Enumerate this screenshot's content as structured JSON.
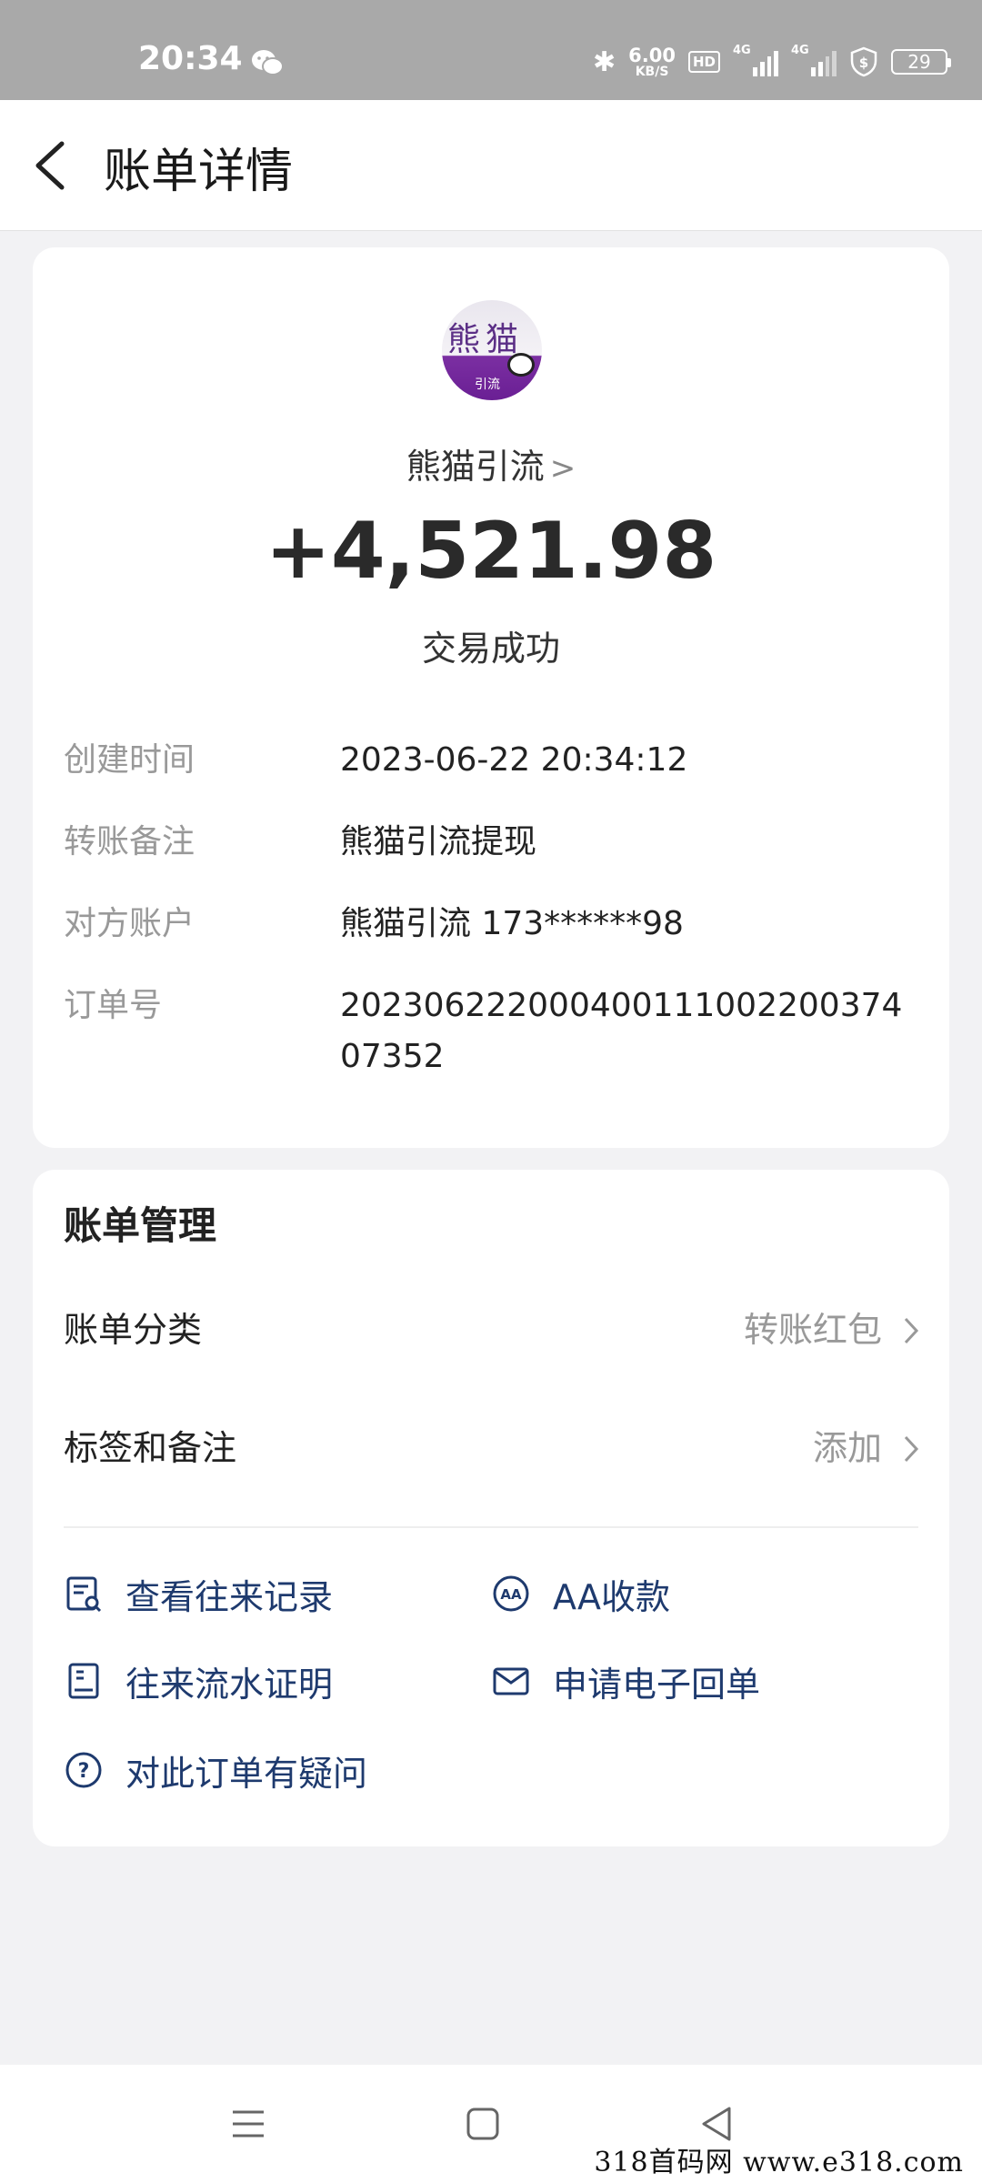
{
  "status_bar": {
    "time": "20:34",
    "speed_value": "6.00",
    "speed_unit": "KB/S",
    "hd_label": "HD",
    "signal_1_label": "4G",
    "signal_2_label": "4G",
    "battery": "29",
    "icons": [
      "wechat-icon",
      "bluetooth-icon",
      "hd-icon",
      "signal-icon",
      "signal-icon",
      "shield-icon",
      "battery-icon"
    ]
  },
  "header": {
    "title": "账单详情",
    "back_icon": "back-arrow-icon"
  },
  "transaction": {
    "avatar_text_top": "熊猫",
    "avatar_text_bottom": "引流",
    "payee": "熊猫引流",
    "amount": "+4,521.98",
    "status": "交易成功"
  },
  "details": [
    {
      "label": "创建时间",
      "value": "2023-06-22 20:34:12"
    },
    {
      "label": "转账备注",
      "value": "熊猫引流提现"
    },
    {
      "label": "对方账户",
      "value": "熊猫引流 173******98"
    },
    {
      "label": "订单号",
      "value": "20230622200040011100220037407352"
    }
  ],
  "management": {
    "title": "账单管理",
    "category_label": "账单分类",
    "category_value": "转账红包",
    "tags_label": "标签和备注",
    "tags_value": "添加",
    "actions": [
      {
        "label": "查看往来记录",
        "icon": "record-icon"
      },
      {
        "label": "AA收款",
        "icon": "aa-icon"
      },
      {
        "label": "往来流水证明",
        "icon": "document-icon"
      },
      {
        "label": "申请电子回单",
        "icon": "envelope-icon"
      },
      {
        "label": "对此订单有疑问",
        "icon": "question-icon"
      }
    ]
  },
  "nav": {
    "icons": [
      "menu-icon",
      "home-icon",
      "back-icon"
    ]
  },
  "watermark": "318首码网 www.e318.com",
  "colors": {
    "action_text": "#1e3a6e",
    "muted_text": "#999999",
    "status_bar": "#a9a9a9",
    "page_bg": "#f2f2f4"
  }
}
